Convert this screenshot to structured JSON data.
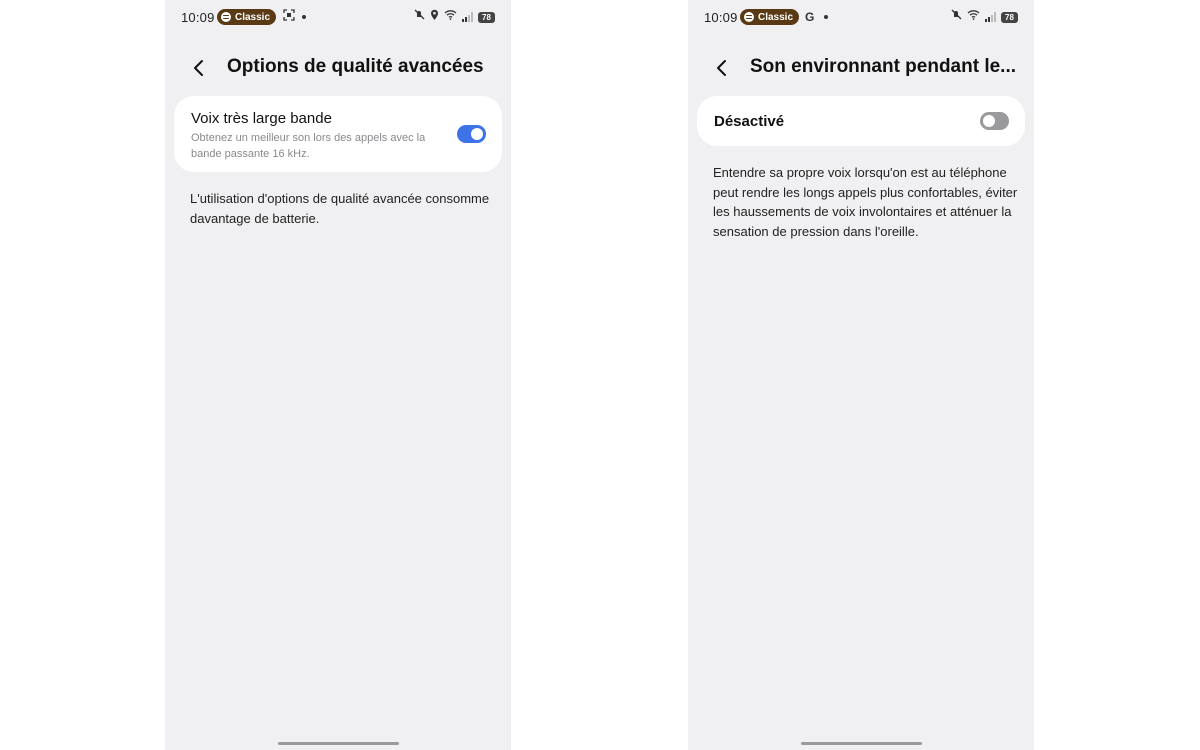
{
  "left_screen": {
    "status": {
      "time": "10:09",
      "media_pill_label": "Classic",
      "media_pill_icon": "spotify-icon",
      "extra_icon": "screenshot-icon",
      "battery": "78"
    },
    "title": "Options de qualité avancées",
    "item": {
      "title": "Voix très large bande",
      "subtitle": "Obtenez un meilleur son lors des appels avec la bande passante 16 kHz.",
      "enabled": true
    },
    "description": "L'utilisation d'options de qualité avancée consomme davantage de batterie."
  },
  "right_screen": {
    "status": {
      "time": "10:09",
      "media_pill_label": "Classic",
      "media_pill_icon": "spotify-icon",
      "extra_icon": "G",
      "battery": "78"
    },
    "title": "Son environnant pendant le...",
    "switch_label": "Désactivé",
    "enabled": false,
    "description": "Entendre sa propre voix lorsqu'on est au téléphone peut rendre les longs appels plus confortables, éviter les haussements de voix involontaires et atténuer la sensation de pression dans l'oreille."
  },
  "colors": {
    "accent": "#3e73e8",
    "pill_background": "#5a3a14",
    "screen_background": "#f0f0f2"
  }
}
